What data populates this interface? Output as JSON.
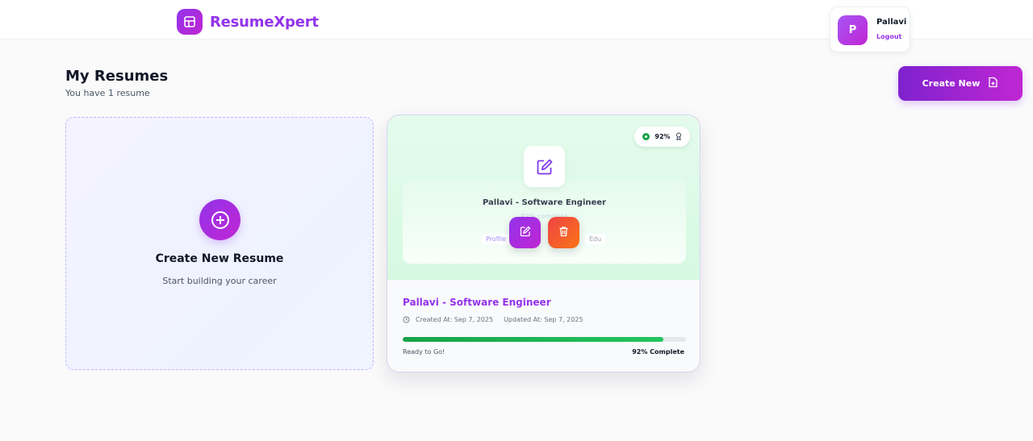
{
  "app": {
    "name": "ResumeXpert",
    "logo_icon": "layout-icon",
    "accent": "#9333ea"
  },
  "user": {
    "initial": "P",
    "name": "Pallavi",
    "logout_label": "Logout"
  },
  "page": {
    "title": "My Resumes",
    "subtitle": "You have 1 resume"
  },
  "toolbar": {
    "create_new_label": "Create New",
    "create_new_icon": "file-plus-icon"
  },
  "create_card": {
    "title": "Create New Resume",
    "subtitle": "Start building your career",
    "icon": "plus-circle-icon"
  },
  "resumes": [
    {
      "preview_title": "Pallavi - Software Engineer",
      "preview_subtitle": "92% complete",
      "chips": [
        "Profile",
        "Edu"
      ],
      "score": "92%",
      "score_icon": "award-icon",
      "title": "Pallavi - Software Engineer",
      "created": "Created At: Sep 7, 2025",
      "updated": "Updated At: Sep 7, 2025",
      "progress": 0.92,
      "status": "Ready to Go!",
      "complete_label": "92% Complete",
      "progress_color": "#16a34a"
    }
  ]
}
